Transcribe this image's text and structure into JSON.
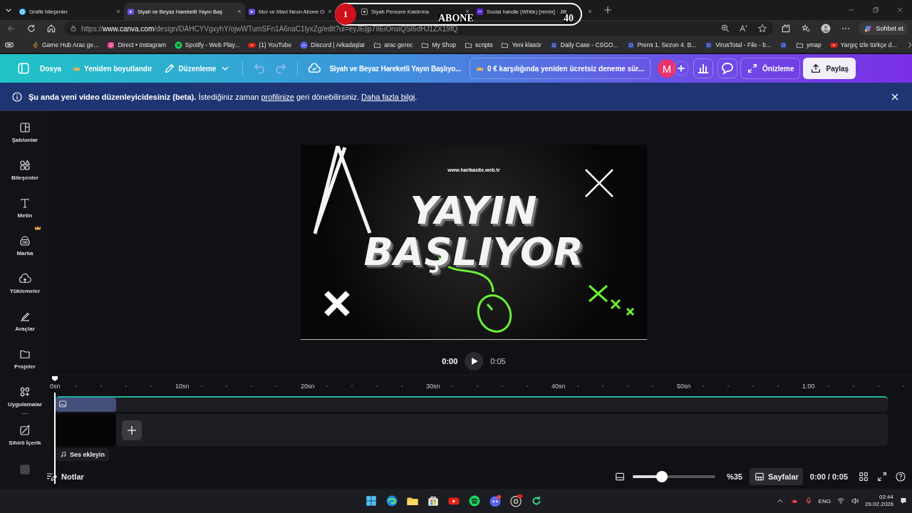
{
  "browser": {
    "tabs": [
      {
        "title": "Grafik bileşenler",
        "selected": false
      },
      {
        "title": "Siyah ve Beyaz Hareketli Yayın Baş",
        "selected": true
      },
      {
        "title": "Mor ve Mavi Neon Abone O",
        "selected": false
      },
      {
        "title": "Siyah Pencere Kaldırma",
        "selected": false
      },
      {
        "title": "Social handle (White) [remix] · Jitt",
        "selected": false
      }
    ],
    "url": {
      "scheme": "https://",
      "host": "www.canva.com",
      "path": "/design/DAHCYVgxyhY/ojwWTumSFn1A6naC1lyxZg/edit?ui=eyJEljp7IlEiOnsiQSI6dHJ1ZX19fQ"
    },
    "copilot": "Sohbet et",
    "bookmarks": [
      {
        "kind": "link",
        "label": "Game Hub Arac ge..."
      },
      {
        "kind": "link",
        "label": "Direct • Instagram"
      },
      {
        "kind": "link",
        "label": "Spotify - Web Play..."
      },
      {
        "kind": "link",
        "label": "(1) YouTube"
      },
      {
        "kind": "link",
        "label": "Discord | Arkadaşlar"
      },
      {
        "kind": "link",
        "label": "arac gerec"
      },
      {
        "kind": "link",
        "label": "My Shop"
      },
      {
        "kind": "link",
        "label": "scripts"
      },
      {
        "kind": "link",
        "label": "Yeni klasör"
      },
      {
        "kind": "link",
        "label": "Daily Case - CSGO..."
      },
      {
        "kind": "link",
        "label": "Prens 1. Sezon 4. B..."
      },
      {
        "kind": "link",
        "label": "VirusTotal - File - b..."
      },
      {
        "kind": "icon"
      },
      {
        "kind": "link",
        "label": "ymap"
      },
      {
        "kind": "link",
        "label": "Yargıç izle türkçe d..."
      }
    ]
  },
  "overlay": {
    "count": "1",
    "label": "ABONE",
    "goal": "40"
  },
  "header": {
    "menu": [
      {
        "label": "Dosya",
        "kind": "plain"
      },
      {
        "label": "Yeniden boyutlandır",
        "kind": "premium"
      },
      {
        "label": "Düzenleme",
        "kind": "edit"
      }
    ],
    "title": "Siyah ve Beyaz Hareketli Yayın Başlıyo...",
    "trial": "0 € karşılığında yeniden ücretsiz deneme sür...",
    "avatar": "M",
    "preview": "Önizleme",
    "share": "Paylaş"
  },
  "banner": {
    "parts": [
      {
        "kind": "bold",
        "text": "Şu anda yeni video düzenleyicidesiniz (beta)."
      },
      {
        "kind": "text",
        "text": " İstediğiniz zaman "
      },
      {
        "kind": "link",
        "text": "profilinize"
      },
      {
        "kind": "text",
        "text": " geri dönebilirsiniz. "
      },
      {
        "kind": "link",
        "text": "Daha fazla bilgi"
      },
      {
        "kind": "text",
        "text": "."
      }
    ]
  },
  "sidebar": {
    "items": [
      {
        "label": "Şablonlar",
        "premium": false
      },
      {
        "label": "Bileşenler",
        "premium": false
      },
      {
        "label": "Metin",
        "premium": false
      },
      {
        "label": "Marka",
        "premium": true
      },
      {
        "label": "Yüklemeler",
        "premium": false
      },
      {
        "label": "Araçlar",
        "premium": false
      },
      {
        "label": "Projeler",
        "premium": false
      },
      {
        "label": "Uygulamalar",
        "premium": false
      },
      {
        "label": "Sihirli İçerik",
        "premium": false
      }
    ]
  },
  "design": {
    "site": "www.harikasite.web.tr",
    "title_lines": [
      "YAYIN",
      "BAŞLIYOR"
    ]
  },
  "player": {
    "current": "0:00",
    "duration": "0:05"
  },
  "timeline": {
    "ticks": [
      "0sn",
      "10sn",
      "20sn",
      "30sn",
      "40sn",
      "50sn",
      "1:00"
    ],
    "add_audio": "Ses ekleyin"
  },
  "footer": {
    "notes": "Notlar",
    "zoom": {
      "level": 0.33,
      "reading": "%35"
    },
    "pages": "Sayfalar",
    "time": "0:00 / 0:05"
  },
  "taskbar": {
    "lang": "ENG",
    "time": "02:44",
    "date": "26.02.2026"
  }
}
